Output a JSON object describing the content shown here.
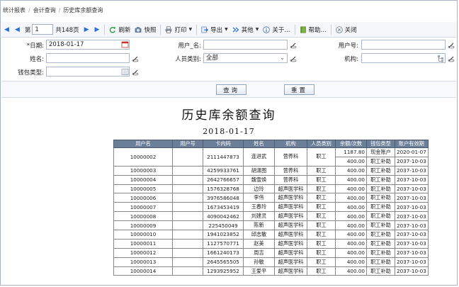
{
  "breadcrumb": [
    "统计报表",
    "会计查询",
    "历史库余额查询"
  ],
  "toolbar": {
    "first": "◀",
    "prev": "◀",
    "page_prefix": "第",
    "page_value": "1",
    "total_pages": "共148页",
    "next": "▶",
    "last": "▶",
    "refresh": "刷新",
    "snapshot": "快照",
    "print": "打印",
    "export": "导出",
    "other": "其他",
    "about": "关于...",
    "help": "帮助...",
    "close": "关闭"
  },
  "form": {
    "date_label": "*日期:",
    "date_value": "2018-01-17",
    "user_name_label": "用户_名:",
    "user_name_value": "",
    "user_no_label": "用户号:",
    "user_no_value": "",
    "name_label": "姓名:",
    "name_value": "",
    "user_type_label": "人员类别:",
    "user_type_value": "全部",
    "dept_label": "机构:",
    "dept_value": "",
    "wallet_label": "钱包类型:",
    "wallet_value": ""
  },
  "buttons": {
    "query": "查询",
    "reset": "重置"
  },
  "report": {
    "title": "历史库余额查询",
    "date": "2018-01-17",
    "columns": [
      "用户名",
      "用户号",
      "卡内码",
      "姓名",
      "机构",
      "人员类别",
      "余额/次数",
      "钱包类型",
      "账户有效期"
    ],
    "rows": [
      [
        "10000002",
        "",
        "2111447873",
        "连进武",
        "营养科",
        "职工",
        "1187.80",
        "现金账户",
        "2020-01-07"
      ],
      [
        "",
        "",
        "",
        "",
        "",
        "",
        "400.00",
        "职工补助",
        "2037-10-03"
      ],
      [
        "10000003",
        "",
        "4259933761",
        "胡潇图",
        "营养科",
        "职工",
        "400.00",
        "职工补助",
        "2037-10-03"
      ],
      [
        "10000004",
        "",
        "2642766657",
        "魏雪焕",
        "营养科",
        "职工",
        "400.00",
        "职工补助",
        "2037-10-03"
      ],
      [
        "10000005",
        "",
        "1576328768",
        "边玲",
        "超声医学科",
        "职工",
        "400.00",
        "职工补助",
        "2037-10-03"
      ],
      [
        "10000006",
        "",
        "3976586048",
        "李伟",
        "超声医学科",
        "职工",
        "400.00",
        "职工补助",
        "2037-10-03"
      ],
      [
        "10000007",
        "",
        "1673453419",
        "王春玲",
        "超声医学科",
        "职工",
        "400.00",
        "职工补助",
        "2037-10-03"
      ],
      [
        "10000008",
        "",
        "4090042462",
        "刘建灵",
        "超声医学科",
        "职工",
        "400.00",
        "职工补助",
        "2037-10-03"
      ],
      [
        "10000009",
        "",
        "225450049",
        "陈新",
        "超声医学科",
        "职工",
        "400.00",
        "职工补助",
        "2037-10-03"
      ],
      [
        "10000010",
        "",
        "1941023852",
        "邱志敏",
        "超声医学科",
        "职工",
        "400.00",
        "职工补助",
        "2037-10-03"
      ],
      [
        "10000011",
        "",
        "1127570771",
        "赵美",
        "超声医学科",
        "职工",
        "400.00",
        "职工补助",
        "2037-10-03"
      ],
      [
        "10000012",
        "",
        "1661240173",
        "周吉",
        "超声医学科",
        "职工",
        "400.00",
        "职工补助",
        "2037-10-03"
      ],
      [
        "10000013",
        "",
        "2645565505",
        "孙敏",
        "超声医学科",
        "职工",
        "400.00",
        "职工补助",
        "2037-10-03"
      ],
      [
        "10000014",
        "",
        "1293925952",
        "王爱平",
        "超声医学科",
        "职工",
        "400.00",
        "职工补助",
        "2037-10-03"
      ]
    ]
  },
  "icons": {
    "refresh": "refresh-icon",
    "snapshot": "camera-icon",
    "print": "printer-icon",
    "export": "export-icon",
    "other": "double-chevron-icon",
    "about": "info-icon",
    "help": "help-book-icon",
    "close": "close-circle-icon"
  },
  "colors": {
    "accent": "#2b6fd6",
    "table_header": "#6b7f99"
  }
}
